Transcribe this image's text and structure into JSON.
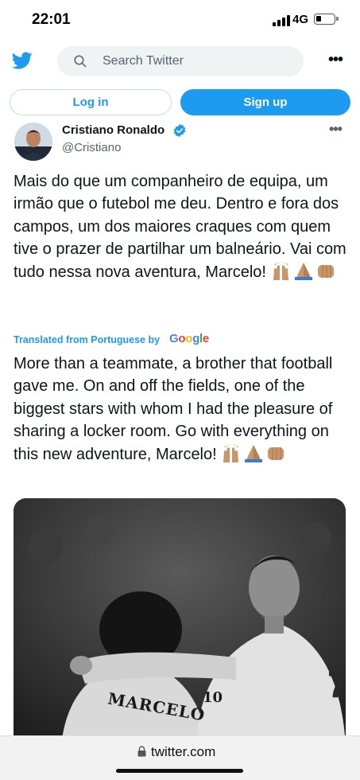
{
  "status_bar": {
    "time": "22:01",
    "network": "4G"
  },
  "top_bar": {
    "search_placeholder": "Search Twitter",
    "more_label": "•••"
  },
  "auth": {
    "login_label": "Log in",
    "signup_label": "Sign up"
  },
  "tweet": {
    "author_name": "Cristiano Ronaldo",
    "author_handle": "@Cristiano",
    "more_label": "•••",
    "text": "Mais do que um companheiro de equipa, um irmão que o futebol me deu. Dentro e fora dos campos, um dos maiores craques com quem tive o prazer de partilhar um balneário. Vai com tudo nessa nova aventura, Marcelo!",
    "translated_by_label": "Translated from Portuguese by",
    "google_label": "Google",
    "translation": "More than a teammate, a brother that football gave me. On and off the fields, one of the biggest stars with whom I had the pleasure of sharing a locker room. Go with everything on this new adventure, Marcelo!",
    "emojis": [
      "raising-hands",
      "folded-hands",
      "oncoming-fist"
    ],
    "media": {
      "jersey_name": "MARCELO",
      "jersey_number": "10"
    }
  },
  "browser": {
    "url": "twitter.com"
  },
  "colors": {
    "twitter_blue": "#1d9bf0",
    "text_primary": "#0f1419",
    "text_secondary": "#536471",
    "search_bg": "#eff3f4",
    "skin_tone": "#c89669"
  }
}
